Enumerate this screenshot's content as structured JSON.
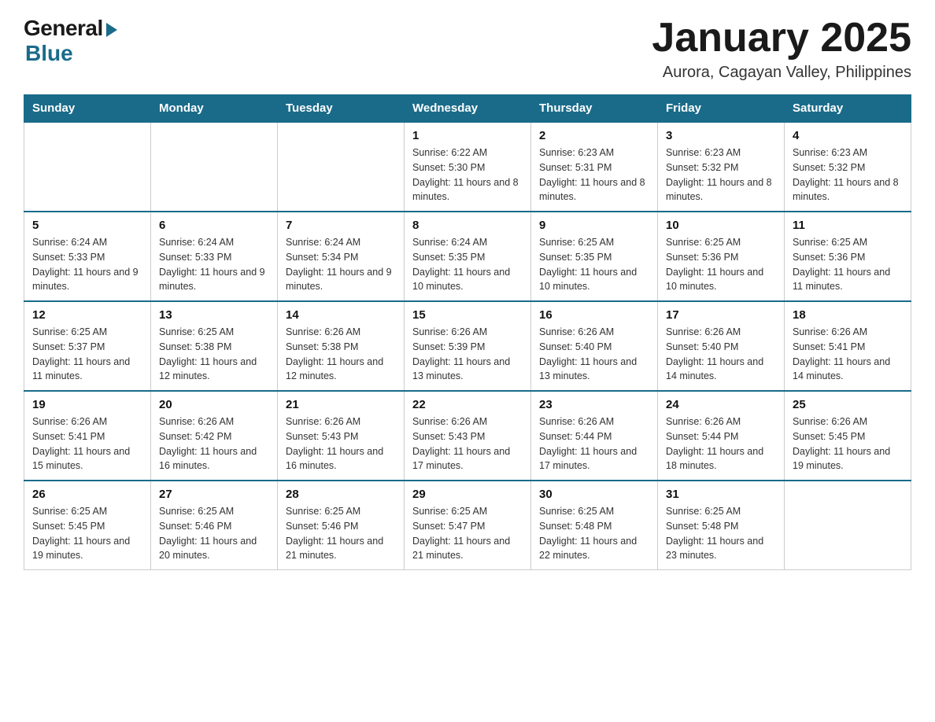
{
  "header": {
    "logo_general": "General",
    "logo_blue": "Blue",
    "title": "January 2025",
    "subtitle": "Aurora, Cagayan Valley, Philippines"
  },
  "calendar": {
    "days_of_week": [
      "Sunday",
      "Monday",
      "Tuesday",
      "Wednesday",
      "Thursday",
      "Friday",
      "Saturday"
    ],
    "weeks": [
      [
        {
          "day": "",
          "info": ""
        },
        {
          "day": "",
          "info": ""
        },
        {
          "day": "",
          "info": ""
        },
        {
          "day": "1",
          "info": "Sunrise: 6:22 AM\nSunset: 5:30 PM\nDaylight: 11 hours and 8 minutes."
        },
        {
          "day": "2",
          "info": "Sunrise: 6:23 AM\nSunset: 5:31 PM\nDaylight: 11 hours and 8 minutes."
        },
        {
          "day": "3",
          "info": "Sunrise: 6:23 AM\nSunset: 5:32 PM\nDaylight: 11 hours and 8 minutes."
        },
        {
          "day": "4",
          "info": "Sunrise: 6:23 AM\nSunset: 5:32 PM\nDaylight: 11 hours and 8 minutes."
        }
      ],
      [
        {
          "day": "5",
          "info": "Sunrise: 6:24 AM\nSunset: 5:33 PM\nDaylight: 11 hours and 9 minutes."
        },
        {
          "day": "6",
          "info": "Sunrise: 6:24 AM\nSunset: 5:33 PM\nDaylight: 11 hours and 9 minutes."
        },
        {
          "day": "7",
          "info": "Sunrise: 6:24 AM\nSunset: 5:34 PM\nDaylight: 11 hours and 9 minutes."
        },
        {
          "day": "8",
          "info": "Sunrise: 6:24 AM\nSunset: 5:35 PM\nDaylight: 11 hours and 10 minutes."
        },
        {
          "day": "9",
          "info": "Sunrise: 6:25 AM\nSunset: 5:35 PM\nDaylight: 11 hours and 10 minutes."
        },
        {
          "day": "10",
          "info": "Sunrise: 6:25 AM\nSunset: 5:36 PM\nDaylight: 11 hours and 10 minutes."
        },
        {
          "day": "11",
          "info": "Sunrise: 6:25 AM\nSunset: 5:36 PM\nDaylight: 11 hours and 11 minutes."
        }
      ],
      [
        {
          "day": "12",
          "info": "Sunrise: 6:25 AM\nSunset: 5:37 PM\nDaylight: 11 hours and 11 minutes."
        },
        {
          "day": "13",
          "info": "Sunrise: 6:25 AM\nSunset: 5:38 PM\nDaylight: 11 hours and 12 minutes."
        },
        {
          "day": "14",
          "info": "Sunrise: 6:26 AM\nSunset: 5:38 PM\nDaylight: 11 hours and 12 minutes."
        },
        {
          "day": "15",
          "info": "Sunrise: 6:26 AM\nSunset: 5:39 PM\nDaylight: 11 hours and 13 minutes."
        },
        {
          "day": "16",
          "info": "Sunrise: 6:26 AM\nSunset: 5:40 PM\nDaylight: 11 hours and 13 minutes."
        },
        {
          "day": "17",
          "info": "Sunrise: 6:26 AM\nSunset: 5:40 PM\nDaylight: 11 hours and 14 minutes."
        },
        {
          "day": "18",
          "info": "Sunrise: 6:26 AM\nSunset: 5:41 PM\nDaylight: 11 hours and 14 minutes."
        }
      ],
      [
        {
          "day": "19",
          "info": "Sunrise: 6:26 AM\nSunset: 5:41 PM\nDaylight: 11 hours and 15 minutes."
        },
        {
          "day": "20",
          "info": "Sunrise: 6:26 AM\nSunset: 5:42 PM\nDaylight: 11 hours and 16 minutes."
        },
        {
          "day": "21",
          "info": "Sunrise: 6:26 AM\nSunset: 5:43 PM\nDaylight: 11 hours and 16 minutes."
        },
        {
          "day": "22",
          "info": "Sunrise: 6:26 AM\nSunset: 5:43 PM\nDaylight: 11 hours and 17 minutes."
        },
        {
          "day": "23",
          "info": "Sunrise: 6:26 AM\nSunset: 5:44 PM\nDaylight: 11 hours and 17 minutes."
        },
        {
          "day": "24",
          "info": "Sunrise: 6:26 AM\nSunset: 5:44 PM\nDaylight: 11 hours and 18 minutes."
        },
        {
          "day": "25",
          "info": "Sunrise: 6:26 AM\nSunset: 5:45 PM\nDaylight: 11 hours and 19 minutes."
        }
      ],
      [
        {
          "day": "26",
          "info": "Sunrise: 6:25 AM\nSunset: 5:45 PM\nDaylight: 11 hours and 19 minutes."
        },
        {
          "day": "27",
          "info": "Sunrise: 6:25 AM\nSunset: 5:46 PM\nDaylight: 11 hours and 20 minutes."
        },
        {
          "day": "28",
          "info": "Sunrise: 6:25 AM\nSunset: 5:46 PM\nDaylight: 11 hours and 21 minutes."
        },
        {
          "day": "29",
          "info": "Sunrise: 6:25 AM\nSunset: 5:47 PM\nDaylight: 11 hours and 21 minutes."
        },
        {
          "day": "30",
          "info": "Sunrise: 6:25 AM\nSunset: 5:48 PM\nDaylight: 11 hours and 22 minutes."
        },
        {
          "day": "31",
          "info": "Sunrise: 6:25 AM\nSunset: 5:48 PM\nDaylight: 11 hours and 23 minutes."
        },
        {
          "day": "",
          "info": ""
        }
      ]
    ]
  }
}
